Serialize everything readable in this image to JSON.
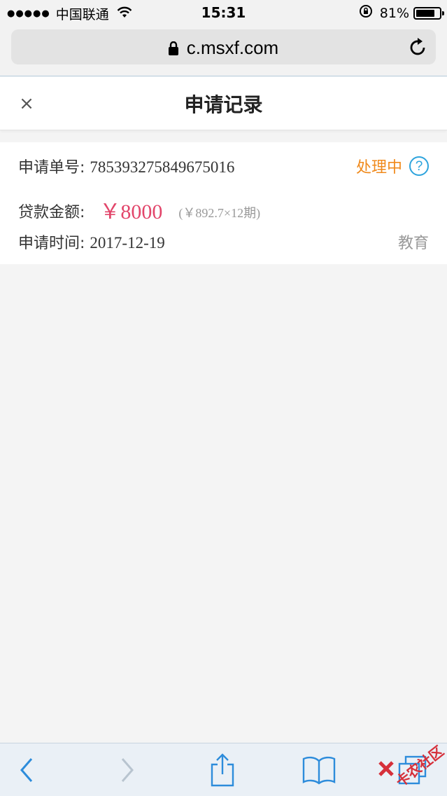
{
  "status_bar": {
    "carrier": "中国联通",
    "time": "15:31",
    "battery": "81%",
    "battery_level": 0.81
  },
  "address_bar": {
    "url": "c.msxf.com"
  },
  "header": {
    "title": "申请记录"
  },
  "record": {
    "order_label": "申请单号:",
    "order_number": "785393275849675016",
    "status": "处理中",
    "amount_label": "贷款金额:",
    "amount": "￥8000",
    "installment": "(￥892.7×12期)",
    "time_label": "申请时间:",
    "date": "2017-12-19",
    "category": "教育"
  },
  "watermark": {
    "text": "卡农社区"
  },
  "colors": {
    "status_orange": "#f08a1c",
    "amount_red": "#e2456a",
    "help_blue": "#2ea4dd",
    "toolbar_blue": "#2d8cdb"
  }
}
